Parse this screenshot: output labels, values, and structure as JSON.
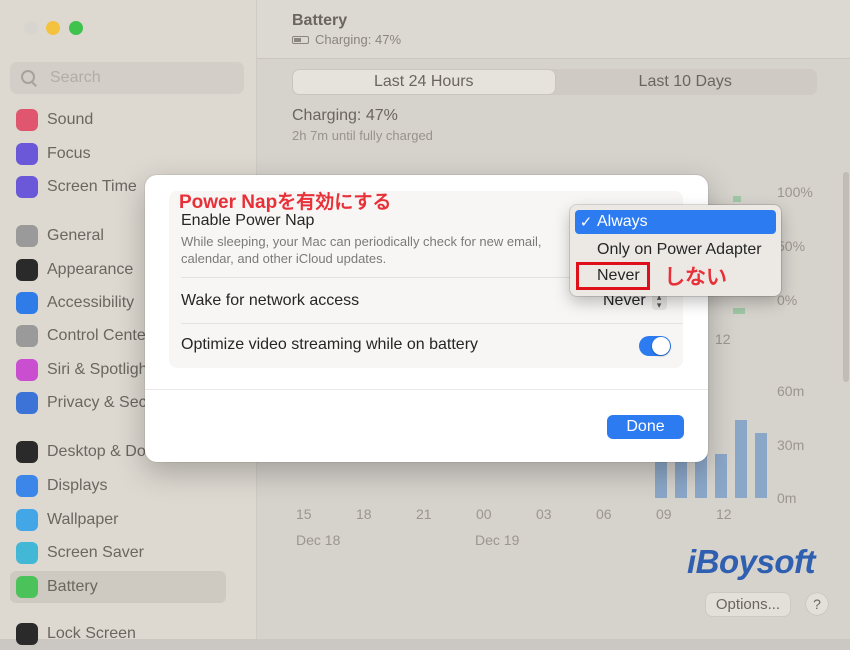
{
  "sidebar": {
    "search_placeholder": "Search",
    "items": [
      {
        "label": "Sound",
        "icon": "speaker-icon",
        "color": "#e0566f"
      },
      {
        "label": "Focus",
        "icon": "moon-icon",
        "color": "#6a58d8"
      },
      {
        "label": "Screen Time",
        "icon": "hourglass-icon",
        "color": "#6a58d8"
      },
      {
        "label": "General",
        "icon": "gear-icon",
        "color": "#9a9a9a"
      },
      {
        "label": "Appearance",
        "icon": "appearance-icon",
        "color": "#2a2a2a"
      },
      {
        "label": "Accessibility",
        "icon": "accessibility-icon",
        "color": "#2f7be8"
      },
      {
        "label": "Control Cente",
        "icon": "control-center-icon",
        "color": "#9a9a9a"
      },
      {
        "label": "Siri & Spotligh",
        "icon": "siri-icon",
        "color": "#c94fd0"
      },
      {
        "label": "Privacy & Sec",
        "icon": "hand-icon",
        "color": "#3b74d6"
      },
      {
        "label": "Desktop & Do",
        "icon": "dock-icon",
        "color": "#2a2a2a"
      },
      {
        "label": "Displays",
        "icon": "sun-icon",
        "color": "#3b86e8"
      },
      {
        "label": "Wallpaper",
        "icon": "wallpaper-icon",
        "color": "#43a6e6"
      },
      {
        "label": "Screen Saver",
        "icon": "screensaver-icon",
        "color": "#43b7d6"
      },
      {
        "label": "Battery",
        "icon": "battery-icon",
        "color": "#4cc35a"
      },
      {
        "label": "Lock Screen",
        "icon": "lock-icon",
        "color": "#2a2a2a"
      }
    ]
  },
  "main": {
    "title": "Battery",
    "subtitle": "Charging: 47%",
    "tabs": [
      {
        "label": "Last 24 Hours",
        "active": true
      },
      {
        "label": "Last 10 Days",
        "active": false
      }
    ],
    "charge_title": "Charging: 47%",
    "charge_sub": "2h 7m until fully charged",
    "options_label": "Options...",
    "help_label": "?",
    "watermark": "iBoysoft"
  },
  "chart_data": {
    "type": "bar",
    "level_axis_ticks": [
      "100%",
      "50%",
      "0%"
    ],
    "level_axis_x_tick": "12",
    "usage_axis_ticks": [
      "60m",
      "30m",
      "0m"
    ],
    "x_ticks": [
      "15",
      "18",
      "21",
      "00",
      "03",
      "06",
      "09",
      "12"
    ],
    "date_labels": [
      "Dec 18",
      "Dec 19"
    ],
    "usage_bars_minutes": [
      38,
      42,
      30,
      25,
      44,
      37
    ]
  },
  "dialog": {
    "power_nap_title": "Enable Power Nap",
    "power_nap_desc": "While sleeping, your Mac can periodically check for new email, calendar, and other iCloud updates.",
    "wake_title": "Wake for network access",
    "wake_value": "Never",
    "optimize_title": "Optimize video streaming while on battery",
    "optimize_on": true,
    "done_label": "Done"
  },
  "dropdown": {
    "options": [
      {
        "label": "Always",
        "checked": true
      },
      {
        "label": "Only on Power Adapter",
        "checked": false
      },
      {
        "label": "Never",
        "checked": false
      }
    ]
  },
  "annotations": {
    "power_nap_jp": "Power Napを有効にする",
    "never_jp": "しない",
    "color": "#e0101a"
  }
}
